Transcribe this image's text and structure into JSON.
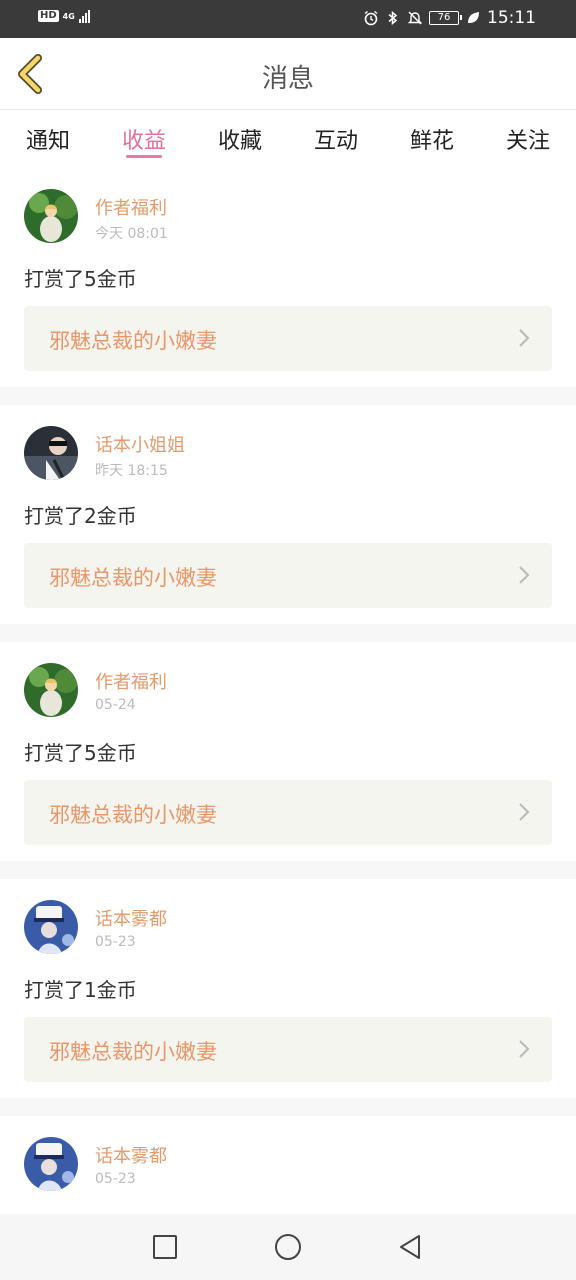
{
  "status_bar": {
    "hd": "HD",
    "network": "4G",
    "battery": "76",
    "time": "15:11"
  },
  "header": {
    "title": "消息"
  },
  "tabs": [
    {
      "label": "通知"
    },
    {
      "label": "收益"
    },
    {
      "label": "收藏"
    },
    {
      "label": "互动"
    },
    {
      "label": "鲜花"
    },
    {
      "label": "关注"
    }
  ],
  "active_tab": "收益",
  "messages": [
    {
      "user": "作者福利",
      "time": "今天 08:01",
      "action": "打赏了5金币",
      "book": "邪魅总裁的小嫩妻",
      "avatar_icon": "avatar-green"
    },
    {
      "user": "话本小姐姐",
      "time": "昨天 18:15",
      "action": "打赏了2金币",
      "book": "邪魅总裁的小嫩妻",
      "avatar_icon": "avatar-dark"
    },
    {
      "user": "作者福利",
      "time": "05-24",
      "action": "打赏了5金币",
      "book": "邪魅总裁的小嫩妻",
      "avatar_icon": "avatar-green"
    },
    {
      "user": "话本雾都",
      "time": "05-23",
      "action": "打赏了1金币",
      "book": "邪魅总裁的小嫩妻",
      "avatar_icon": "avatar-blue"
    },
    {
      "user": "话本雾都",
      "time": "05-23",
      "action": "",
      "book": "",
      "avatar_icon": "avatar-blue"
    }
  ],
  "colors": {
    "accent_tab": "#e0709c",
    "username": "#e39b6b",
    "book_title": "#e8976a",
    "back_arrow": "#f2d86a"
  }
}
